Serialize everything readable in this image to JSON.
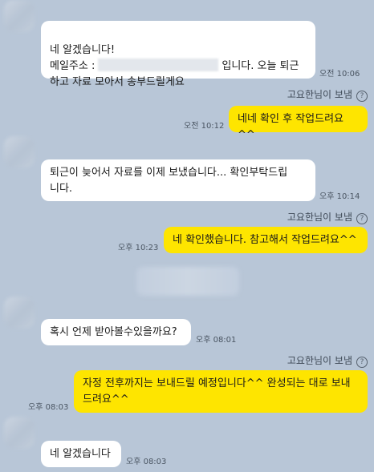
{
  "messages": [
    {
      "type": "in",
      "lines": [
        "네 알겠습니다!",
        "메일주소 :",
        "입니다. 오늘 퇴근",
        "하고 자료 모아서 송부드릴게요"
      ],
      "time": "오전 10:06"
    },
    {
      "type": "out",
      "sender": "고요한님이 보냄",
      "text": "네네 확인 후 작업드려요^^",
      "time": "오전 10:12"
    },
    {
      "type": "in",
      "text": "퇴근이 늦어서 자료를 이제 보냈습니다... 확인부탁드립\n니다.",
      "time": "오후 10:14"
    },
    {
      "type": "out",
      "sender": "고요한님이 보냄",
      "text": "네 확인했습니다. 참고해서 작업드려요^^",
      "time": "오후 10:23"
    },
    {
      "type": "in",
      "text": "혹시 언제 받아볼수있을까요?",
      "time": "오후 08:01"
    },
    {
      "type": "out",
      "sender": "고요한님이 보냄",
      "text": "자정 전후까지는 보내드릴 예정입니다^^ 완성되는 대로 보내\n드려요^^",
      "time": "오후 08:03"
    },
    {
      "type": "in",
      "text": "네 알겠습니다",
      "time": "오후 08:03"
    }
  ],
  "help_icon": "?",
  "icons": {
    "help": "question-circle-icon",
    "avatar": "blurred-avatar"
  },
  "colors": {
    "background": "#b8c6d7",
    "outgoing": "#fee500",
    "incoming": "#ffffff"
  }
}
